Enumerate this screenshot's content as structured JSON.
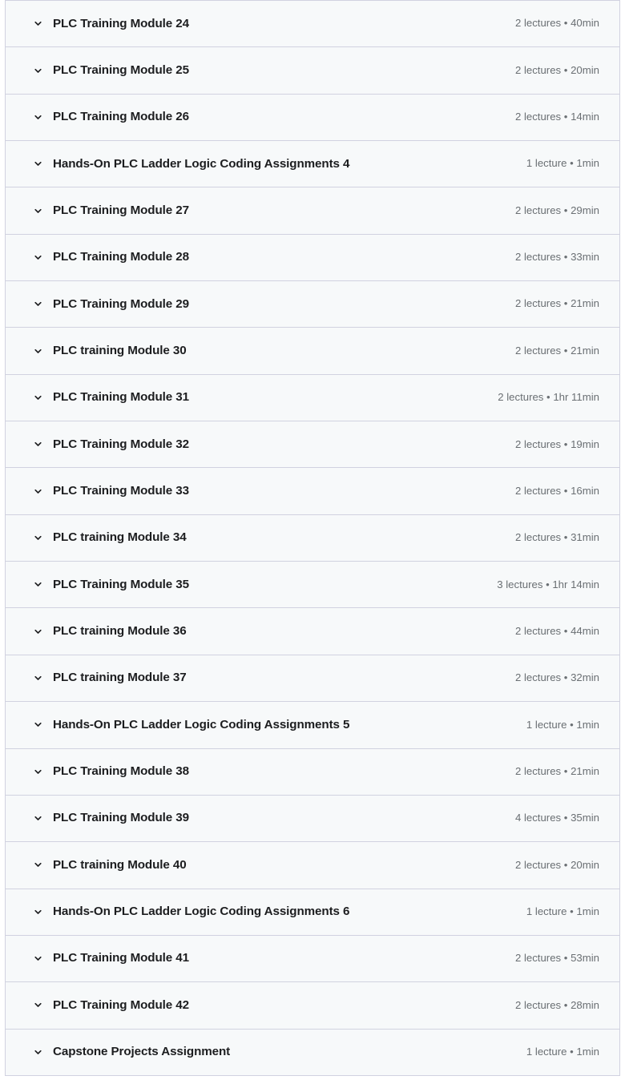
{
  "panel": {
    "name": "course-curriculum-accordion",
    "accent_border_color": "#d1d2e0",
    "row_background_color": "#f7f9fa",
    "title_color": "#1c1d1f",
    "meta_color": "#6a6f73",
    "chevron_icon": "chevron-down-icon"
  },
  "sections": [
    {
      "title": "PLC Training Module 24",
      "meta": "2 lectures • 40min",
      "lectures": 2,
      "duration": "40min"
    },
    {
      "title": "PLC Training Module 25",
      "meta": "2 lectures • 20min",
      "lectures": 2,
      "duration": "20min"
    },
    {
      "title": "PLC Training Module 26",
      "meta": "2 lectures • 14min",
      "lectures": 2,
      "duration": "14min"
    },
    {
      "title": "Hands-On PLC Ladder Logic Coding Assignments 4",
      "meta": "1 lecture • 1min",
      "lectures": 1,
      "duration": "1min"
    },
    {
      "title": "PLC Training Module 27",
      "meta": "2 lectures • 29min",
      "lectures": 2,
      "duration": "29min"
    },
    {
      "title": "PLC Training Module 28",
      "meta": "2 lectures • 33min",
      "lectures": 2,
      "duration": "33min"
    },
    {
      "title": "PLC Training Module 29",
      "meta": "2 lectures • 21min",
      "lectures": 2,
      "duration": "21min"
    },
    {
      "title": "PLC training Module 30",
      "meta": "2 lectures • 21min",
      "lectures": 2,
      "duration": "21min"
    },
    {
      "title": "PLC Training Module 31",
      "meta": "2 lectures • 1hr 11min",
      "lectures": 2,
      "duration": "1hr 11min"
    },
    {
      "title": "PLC Training Module 32",
      "meta": "2 lectures • 19min",
      "lectures": 2,
      "duration": "19min"
    },
    {
      "title": "PLC Training Module 33",
      "meta": "2 lectures • 16min",
      "lectures": 2,
      "duration": "16min"
    },
    {
      "title": "PLC training Module 34",
      "meta": "2 lectures • 31min",
      "lectures": 2,
      "duration": "31min"
    },
    {
      "title": "PLC Training Module 35",
      "meta": "3 lectures • 1hr 14min",
      "lectures": 3,
      "duration": "1hr 14min"
    },
    {
      "title": "PLC training Module 36",
      "meta": "2 lectures • 44min",
      "lectures": 2,
      "duration": "44min"
    },
    {
      "title": "PLC training Module 37",
      "meta": "2 lectures • 32min",
      "lectures": 2,
      "duration": "32min"
    },
    {
      "title": "Hands-On PLC Ladder Logic Coding Assignments 5",
      "meta": "1 lecture • 1min",
      "lectures": 1,
      "duration": "1min"
    },
    {
      "title": "PLC Training Module 38",
      "meta": "2 lectures • 21min",
      "lectures": 2,
      "duration": "21min"
    },
    {
      "title": "PLC Training Module 39",
      "meta": "4 lectures • 35min",
      "lectures": 4,
      "duration": "35min"
    },
    {
      "title": "PLC training Module 40",
      "meta": "2 lectures • 20min",
      "lectures": 2,
      "duration": "20min"
    },
    {
      "title": "Hands-On PLC Ladder Logic Coding Assignments 6",
      "meta": "1 lecture • 1min",
      "lectures": 1,
      "duration": "1min"
    },
    {
      "title": "PLC Training Module 41",
      "meta": "2 lectures • 53min",
      "lectures": 2,
      "duration": "53min"
    },
    {
      "title": "PLC Training Module 42",
      "meta": "2 lectures • 28min",
      "lectures": 2,
      "duration": "28min"
    },
    {
      "title": "Capstone Projects Assignment",
      "meta": "1 lecture • 1min",
      "lectures": 1,
      "duration": "1min"
    }
  ]
}
